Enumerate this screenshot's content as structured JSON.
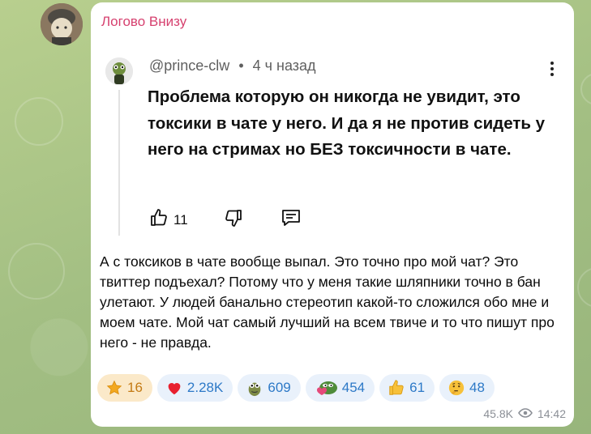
{
  "channel": {
    "name": "Логово Внизу"
  },
  "screenshot": {
    "author": "@prince-clw",
    "separator": "•",
    "time_ago": "4 ч назад",
    "comment": "Проблема которую он никогда не увидит, это токсики в чате у него. И да я не против сидеть у него на стримах но БЕЗ токсичности в чате.",
    "likes": "11"
  },
  "message": {
    "text": "А с токсиков в чате вообще выпал. Это точно про мой чат? Это твиттер подъехал? Потому что у меня такие шляпники точно в бан улетают. У людей банально стереотип какой-то сложился обо мне и моем чате. Мой чат самый лучший на всем твиче и то что пишут про него - не правда."
  },
  "reactions": [
    {
      "icon": "star-icon",
      "count": "16",
      "chosen": true
    },
    {
      "icon": "heart-icon",
      "count": "2.28K"
    },
    {
      "icon": "frog-sticker-icon",
      "count": "609"
    },
    {
      "icon": "pepe-sticker-icon",
      "count": "454"
    },
    {
      "icon": "thumbs-up-icon",
      "count": "61"
    },
    {
      "icon": "thinking-face-icon",
      "count": "48"
    }
  ],
  "meta": {
    "views": "45.8K",
    "time": "14:42"
  },
  "colors": {
    "accent": "#d6416f",
    "reaction_text": "#2d79c7",
    "reaction_bg": "#e9f1fb",
    "background": "#a9c487"
  }
}
